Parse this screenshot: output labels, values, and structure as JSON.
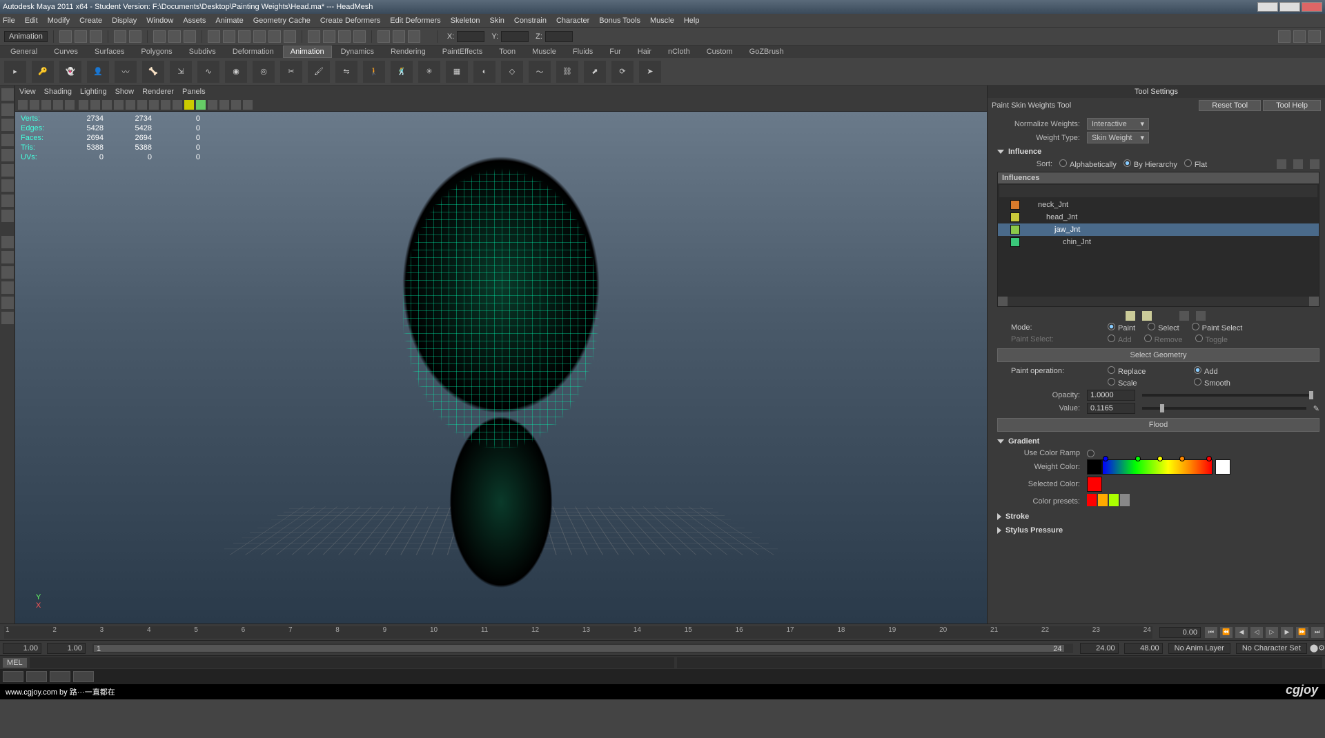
{
  "title": "Autodesk Maya 2011 x64 - Student Version: F:\\Documents\\Desktop\\Painting Weights\\Head.ma* --- HeadMesh",
  "menus": [
    "File",
    "Edit",
    "Modify",
    "Create",
    "Display",
    "Window",
    "Assets",
    "Animate",
    "Geometry Cache",
    "Create Deformers",
    "Edit Deformers",
    "Skeleton",
    "Skin",
    "Constrain",
    "Character",
    "Bonus Tools",
    "Muscle",
    "Help"
  ],
  "mode": "Animation",
  "coord_labels": [
    "X:",
    "Y:",
    "Z:"
  ],
  "shelf_tabs": [
    "General",
    "Curves",
    "Surfaces",
    "Polygons",
    "Subdivs",
    "Deformation",
    "Animation",
    "Dynamics",
    "Rendering",
    "PaintEffects",
    "Toon",
    "Muscle",
    "Fluids",
    "Fur",
    "Hair",
    "nCloth",
    "Custom",
    "GoZBrush"
  ],
  "shelf_active": 6,
  "vp_menus": [
    "View",
    "Shading",
    "Lighting",
    "Show",
    "Renderer",
    "Panels"
  ],
  "hud": [
    {
      "label": "Verts:",
      "v1": "2734",
      "v2": "2734",
      "v3": "0"
    },
    {
      "label": "Edges:",
      "v1": "5428",
      "v2": "5428",
      "v3": "0"
    },
    {
      "label": "Faces:",
      "v1": "2694",
      "v2": "2694",
      "v3": "0"
    },
    {
      "label": "Tris:",
      "v1": "5388",
      "v2": "5388",
      "v3": "0"
    },
    {
      "label": "UVs:",
      "v1": "0",
      "v2": "0",
      "v3": "0"
    }
  ],
  "axis_labels": {
    "y": "Y",
    "x": "X"
  },
  "tool_settings_title": "Tool Settings",
  "tool_name": "Paint Skin Weights Tool",
  "reset_tool": "Reset Tool",
  "tool_help": "Tool Help",
  "normalize_label": "Normalize Weights:",
  "normalize_value": "Interactive",
  "weight_type_label": "Weight Type:",
  "weight_type_value": "Skin Weight",
  "influence_head": "Influence",
  "sort_label": "Sort:",
  "sort_opts": [
    "Alphabetically",
    "By Hierarchy",
    "Flat"
  ],
  "sort_selected": 1,
  "influences_label": "Influences",
  "influences": [
    {
      "name": "neck_Jnt",
      "color": "#d97a2b",
      "indent": 20
    },
    {
      "name": "head_Jnt",
      "color": "#c9c93a",
      "indent": 32
    },
    {
      "name": "jaw_Jnt",
      "color": "#8ac94a",
      "indent": 44,
      "selected": true
    },
    {
      "name": "chin_Jnt",
      "color": "#3ac97a",
      "indent": 56
    }
  ],
  "mode_label": "Mode:",
  "mode_opts": [
    "Paint",
    "Select",
    "Paint Select"
  ],
  "paint_select_label": "Paint Select:",
  "paint_select_opts": [
    "Add",
    "Remove",
    "Toggle"
  ],
  "select_geometry": "Select Geometry",
  "paint_op_label": "Paint operation:",
  "paint_ops_row1": [
    "Replace",
    "Add"
  ],
  "paint_ops_row2": [
    "Scale",
    "Smooth"
  ],
  "paint_op_selected": "Add",
  "opacity_label": "Opacity:",
  "opacity_value": "1.0000",
  "value_label": "Value:",
  "value_value": "0.1165",
  "flood_label": "Flood",
  "gradient_head": "Gradient",
  "use_color_ramp": "Use Color Ramp",
  "weight_color_label": "Weight Color:",
  "selected_color_label": "Selected Color:",
  "color_presets_label": "Color presets:",
  "selected_color": "#ff0000",
  "preset_colors": [
    "#ff0000",
    "#ffaa00",
    "#aaff00",
    "#888888"
  ],
  "stroke_head": "Stroke",
  "stylus_head": "Stylus Pressure",
  "timeline_ticks": [
    "1",
    "2",
    "3",
    "4",
    "5",
    "6",
    "7",
    "8",
    "9",
    "10",
    "11",
    "12",
    "13",
    "14",
    "15",
    "16",
    "17",
    "18",
    "19",
    "20",
    "21",
    "22",
    "23",
    "24"
  ],
  "current_time": "0.00",
  "range_start": "1.00",
  "range_anim_start": "1.00",
  "range_cursor_a": "1",
  "range_cursor_b": "24",
  "range_anim_end": "24.00",
  "range_end": "48.00",
  "anim_layer": "No Anim Layer",
  "char_set": "No Character Set",
  "mel_label": "MEL",
  "footer_text": "www.cgjoy.com by 路···一直都在",
  "watermark": "cgjoy"
}
